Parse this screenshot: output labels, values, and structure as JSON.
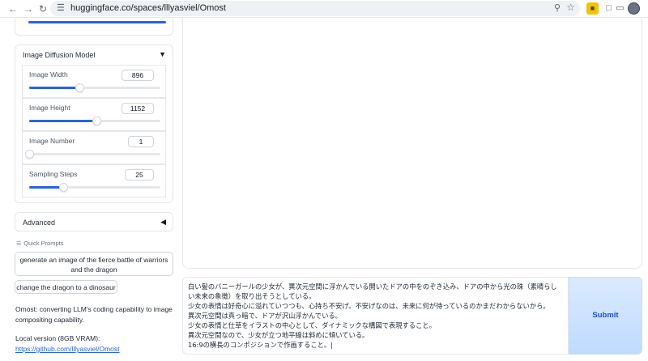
{
  "browser": {
    "url": "huggingface.co/spaces/lllyasviel/Omost",
    "icons": [
      "back-arrow-icon",
      "forward-arrow-icon",
      "reload-icon",
      "site-settings-icon",
      "zoom-icon",
      "bookmark-star-icon",
      "extension-icon",
      "puzzle-icon",
      "profile-avatar-icon"
    ]
  },
  "image_diffusion": {
    "title": "Image Diffusion Model",
    "sliders": [
      {
        "label": "Image Width",
        "value": "896",
        "fraction": 0.38
      },
      {
        "label": "Image Height",
        "value": "1152",
        "fraction": 0.51
      },
      {
        "label": "Image Number",
        "value": "1",
        "fraction": 0.0
      },
      {
        "label": "Sampling Steps",
        "value": "25",
        "fraction": 0.26
      }
    ]
  },
  "advanced": {
    "title": "Advanced"
  },
  "quick_prompts": {
    "label": "Quick Prompts",
    "items": [
      "generate an image of the fierce battle of warriors and the dragon",
      "change the dragon to a dinosaur"
    ]
  },
  "info": {
    "description": "Omost: converting LLM's coding capability to image compositing capability.",
    "local_version": "Local version (8GB VRAM):",
    "github_link": "https://github.com/lllyasviel/Omost"
  },
  "prompt": {
    "text": "白い髪のバニーガールの少女が、異次元空間に浮かんでいる開いたドアの中をのぞき込み、ドアの中から光の珠（素晴らしい未来の象徴）を取り出そうとしている。\n少女の表情は好奇心に溢れていつつも、心持ち不安げ。不安げなのは、未来に何が待っているのかまだわからないから。\n異次元空間は真っ暗で、ドアが沢山浮かんでいる。\n少女の表情と仕草をイラストの中心として、ダイナミックな構図で表現すること。\n異次元空間なので、少女が立つ地平線は斜めに傾いている。\n16:9の横長のコンポジションで作画すること。|"
  },
  "submit": {
    "label": "Submit"
  },
  "colors": {
    "accent": "#2563eb",
    "submit_bg": "#bfdbfe",
    "submit_text": "#1d4ed8"
  }
}
